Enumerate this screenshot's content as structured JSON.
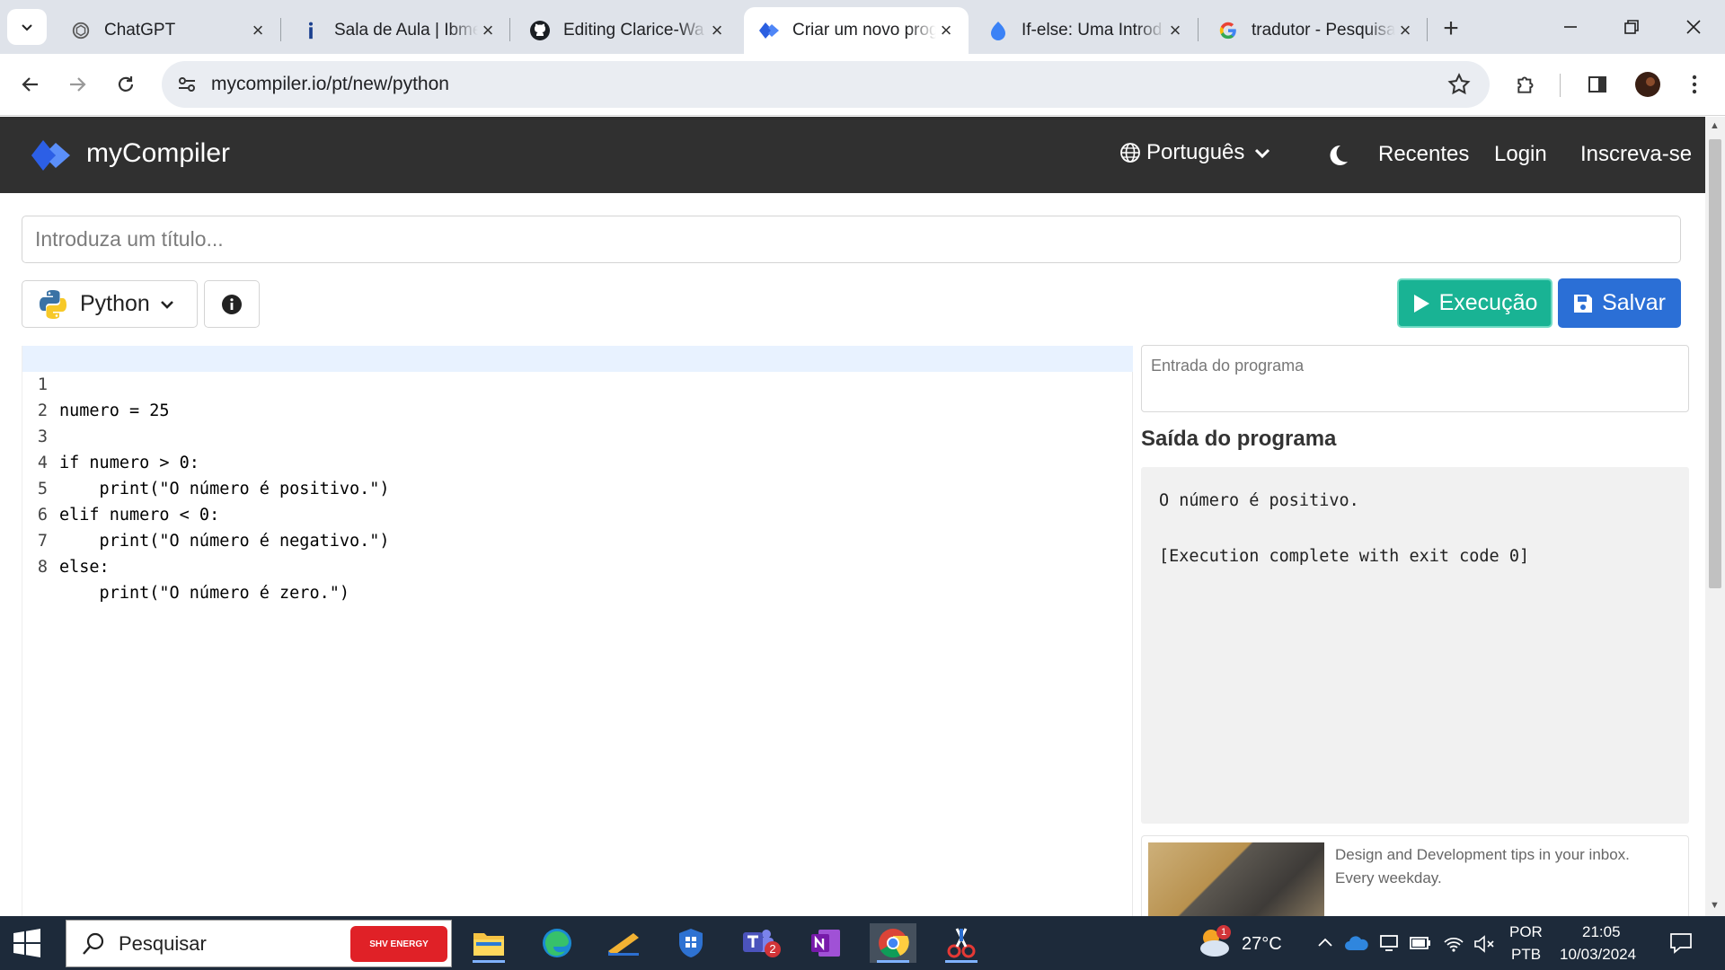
{
  "browser": {
    "tabs": [
      {
        "title": "ChatGPT",
        "icon": "chatgpt-icon",
        "active": false
      },
      {
        "title": "Sala de Aula | Ibmec",
        "icon": "ibmec-icon",
        "active": false
      },
      {
        "title": "Editing Clarice-Wa",
        "icon": "github-icon",
        "active": false
      },
      {
        "title": "Criar um novo prog",
        "icon": "mycompiler-icon",
        "active": true
      },
      {
        "title": "If-else: Uma Introd",
        "icon": "drop-icon",
        "active": false
      },
      {
        "title": "tradutor - Pesquisa",
        "icon": "google-icon",
        "active": false
      }
    ],
    "url": "mycompiler.io/pt/new/python"
  },
  "site": {
    "brand": "myCompiler",
    "language": "Português",
    "nav": {
      "recent": "Recentes",
      "login": "Login",
      "signup": "Inscreva-se"
    }
  },
  "editor": {
    "title_placeholder": "Introduza um título...",
    "language": "Python",
    "run_label": "Execução",
    "save_label": "Salvar",
    "lines": [
      "numero = 25",
      "",
      "if numero > 0:",
      "    print(\"O número é positivo.\")",
      "elif numero < 0:",
      "    print(\"O número é negativo.\")",
      "else:",
      "    print(\"O número é zero.\")"
    ],
    "line_numbers": [
      "1",
      "2",
      "3",
      "4",
      "5",
      "6",
      "7",
      "8"
    ]
  },
  "io": {
    "input_placeholder": "Entrada do programa",
    "output_title": "Saída do programa",
    "output_lines": [
      "O número é positivo.",
      "",
      "[Execution complete with exit code 0]"
    ]
  },
  "ad": {
    "text": "Design and Development tips in your inbox. Every weekday."
  },
  "taskbar": {
    "search_placeholder": "Pesquisar",
    "search_badge": "SHV ENERGY",
    "weather": "27°C",
    "weather_badge": "1",
    "teams_badge": "2",
    "lang_line1": "POR",
    "lang_line2": "PTB",
    "time": "21:05",
    "date": "10/03/2024"
  },
  "colors": {
    "run": "#19b394",
    "save": "#2b6fd6",
    "header": "#303030"
  }
}
